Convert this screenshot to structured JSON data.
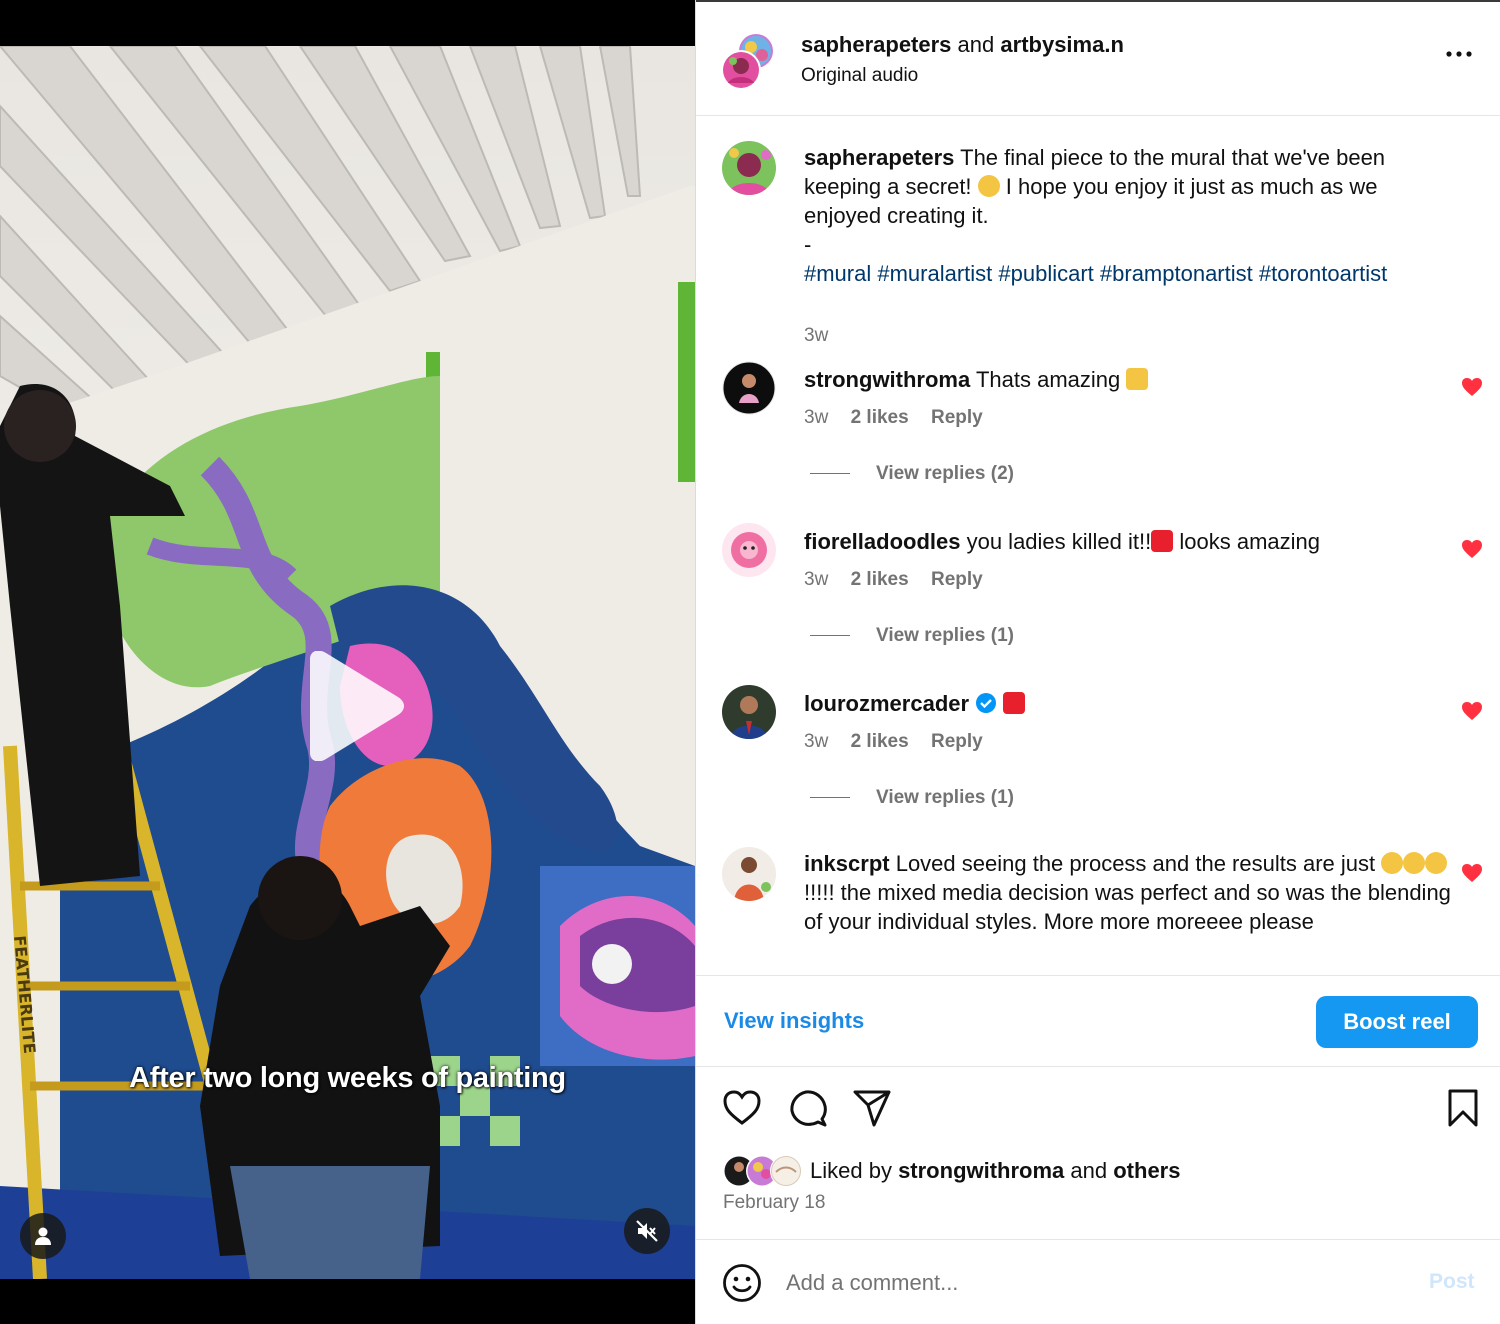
{
  "video": {
    "caption": "After two long weeks of painting",
    "ladder_brand": "FEATHERLITE",
    "icons": {
      "play": "play-icon",
      "user": "user-icon",
      "mute": "speaker-muted-icon"
    }
  },
  "header": {
    "user1": "sapherapeters",
    "and": "and",
    "user2": "artbysima.n",
    "audio": "Original audio",
    "more_icon": "more-options-icon"
  },
  "caption_post": {
    "username": "sapherapeters",
    "text1": " The final piece to the mural that we've been keeping a secret! ",
    "text2": " I hope you enjoy it just as much as we enjoyed creating it.",
    "dash": "-",
    "hashtags": "#mural #muralartist #publicart #bramptonartist #torontoartist",
    "time": "3w"
  },
  "comments": [
    {
      "username": "strongwithroma",
      "text": " Thats amazing ",
      "time": "3w",
      "likes": "2 likes",
      "reply": "Reply",
      "view_replies": "View replies (2)"
    },
    {
      "username": "fiorelladoodles",
      "text_a": " you ladies killed it!!",
      "text_b": " looks amazing",
      "time": "3w",
      "likes": "2 likes",
      "reply": "Reply",
      "view_replies": "View replies (1)"
    },
    {
      "username": "lourozmercader",
      "time": "3w",
      "likes": "2 likes",
      "reply": "Reply",
      "view_replies": "View replies (1)"
    },
    {
      "username": "inkscrpt",
      "text_a": " Loved seeing the process and the results are just",
      "text_b": "!!!!! the mixed media decision was perfect and so was the blending of your individual styles. More more moreeee please"
    }
  ],
  "actions": {
    "insights": "View insights",
    "boost": "Boost reel"
  },
  "likes": {
    "prefix": "Liked by ",
    "user": "strongwithroma",
    "and": " and ",
    "others": "others",
    "date": "February 18"
  },
  "add_comment": {
    "placeholder": "Add a comment...",
    "post": "Post"
  },
  "colors": {
    "accent": "#1498f2",
    "link": "#00376b",
    "like_red": "#ff3040",
    "muted": "#737373"
  }
}
